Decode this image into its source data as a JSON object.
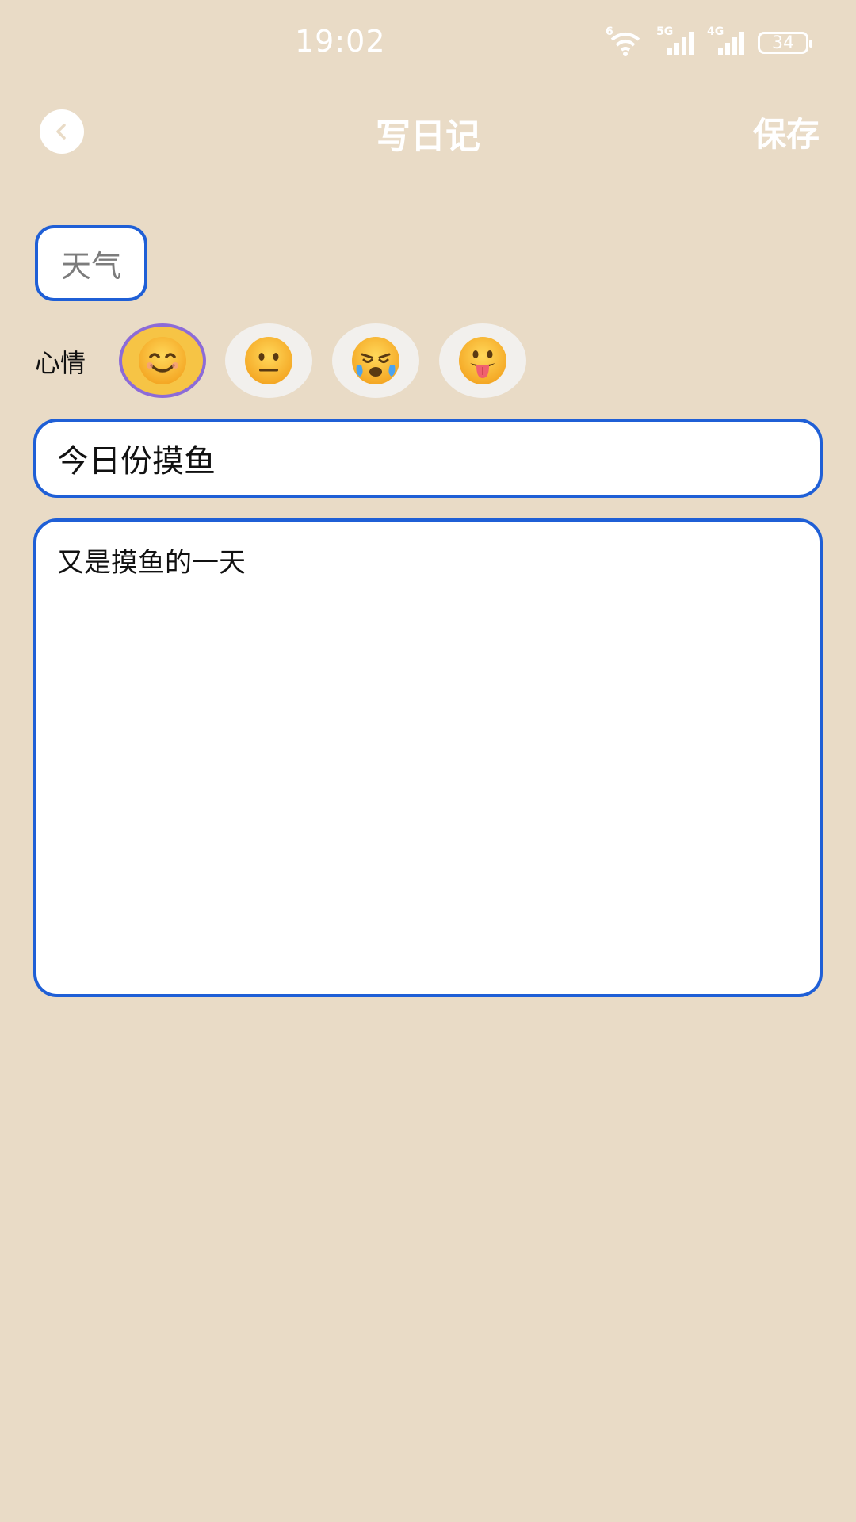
{
  "status_bar": {
    "time": "19:02",
    "wifi_tag": "6",
    "signal1_tag": "5G",
    "signal2_tag": "4G",
    "battery": "34"
  },
  "header": {
    "title": "写日记",
    "save_label": "保存",
    "back_icon": "chevron-left-icon"
  },
  "weather": {
    "label": "天气"
  },
  "mood": {
    "label": "心情",
    "options": [
      "smiling-face",
      "neutral-face",
      "crying-face",
      "tongue-face"
    ],
    "selected": "smiling-face",
    "selected_color": "#f6c445",
    "selected_border": "#8c6bd8"
  },
  "entry": {
    "title_value": "今日份摸鱼",
    "content_value": "又是摸鱼的一天"
  },
  "colors": {
    "background": "#e9dbc6",
    "accent": "#1f5fd6"
  }
}
